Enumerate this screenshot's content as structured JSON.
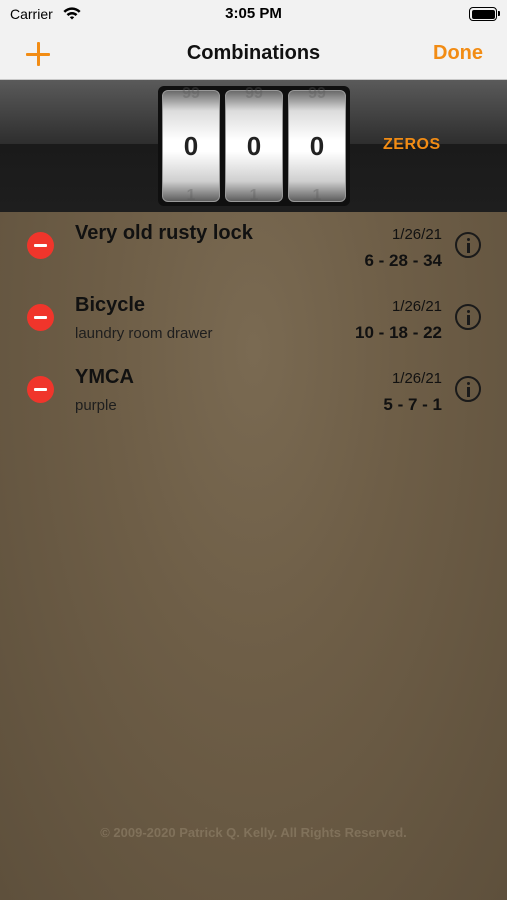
{
  "status": {
    "carrier": "Carrier",
    "time": "3:05 PM"
  },
  "nav": {
    "title": "Combinations",
    "done_label": "Done"
  },
  "dials": {
    "digits": [
      "0",
      "0",
      "0"
    ],
    "mode_label": "ZEROS"
  },
  "combinations": [
    {
      "name": "Very old rusty lock",
      "note": "",
      "date": "1/26/21",
      "combo": "6 - 28 - 34"
    },
    {
      "name": "Bicycle",
      "note": "laundry room drawer",
      "date": "1/26/21",
      "combo": "10 - 18 - 22"
    },
    {
      "name": "YMCA",
      "note": "purple",
      "date": "1/26/21",
      "combo": "5 - 7 - 1"
    }
  ],
  "footer": {
    "copyright": "© 2009-2020 Patrick Q. Kelly. All Rights Reserved."
  },
  "colors": {
    "accent": "#f28c14",
    "delete": "#f0352b",
    "background": "#6e5e47"
  }
}
